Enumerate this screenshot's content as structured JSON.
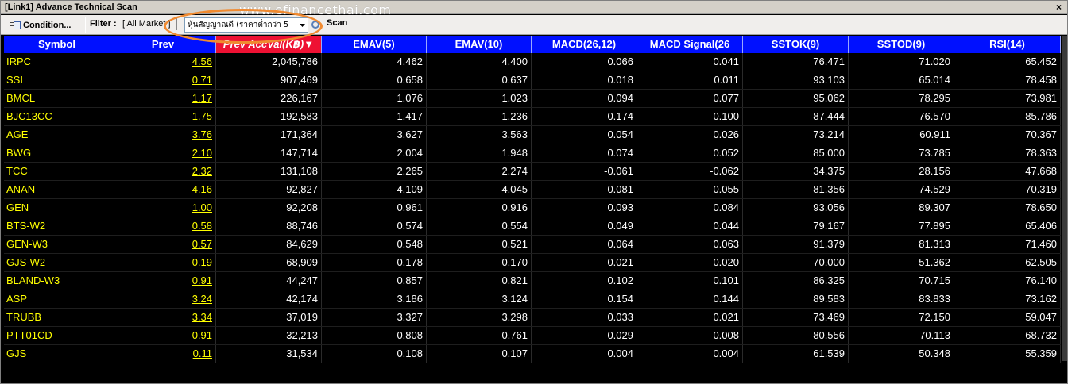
{
  "window": {
    "title": "[Link1] Advance Technical Scan",
    "close_glyph": "×",
    "watermark": "www.efinancethai.com"
  },
  "toolbar": {
    "condition_label": "Condition...",
    "filter_label": "Filter :",
    "filter_value": "[ All Market ]",
    "scan_select_value": "หุ้นสัญญาณดี (ราคาต่ำกว่า 5",
    "scan_label": "Scan"
  },
  "grid": {
    "columns": [
      "Symbol",
      "Prev",
      "Prev AccVal(K฿)",
      "EMAV(5)",
      "EMAV(10)",
      "MACD(26,12)",
      "MACD Signal(26",
      "SSTOK(9)",
      "SSTOD(9)",
      "RSI(14)"
    ],
    "sort_indicator": "▼",
    "rows": [
      [
        "IRPC",
        "4.56",
        "2,045,786",
        "4.462",
        "4.400",
        "0.066",
        "0.041",
        "76.471",
        "71.020",
        "65.452"
      ],
      [
        "SSI",
        "0.71",
        "907,469",
        "0.658",
        "0.637",
        "0.018",
        "0.011",
        "93.103",
        "65.014",
        "78.458"
      ],
      [
        "BMCL",
        "1.17",
        "226,167",
        "1.076",
        "1.023",
        "0.094",
        "0.077",
        "95.062",
        "78.295",
        "73.981"
      ],
      [
        "BJC13CC",
        "1.75",
        "192,583",
        "1.417",
        "1.236",
        "0.174",
        "0.100",
        "87.444",
        "76.570",
        "85.786"
      ],
      [
        "AGE",
        "3.76",
        "171,364",
        "3.627",
        "3.563",
        "0.054",
        "0.026",
        "73.214",
        "60.911",
        "70.367"
      ],
      [
        "BWG",
        "2.10",
        "147,714",
        "2.004",
        "1.948",
        "0.074",
        "0.052",
        "85.000",
        "73.785",
        "78.363"
      ],
      [
        "TCC",
        "2.32",
        "131,108",
        "2.265",
        "2.274",
        "-0.061",
        "-0.062",
        "34.375",
        "28.156",
        "47.668"
      ],
      [
        "ANAN",
        "4.16",
        "92,827",
        "4.109",
        "4.045",
        "0.081",
        "0.055",
        "81.356",
        "74.529",
        "70.319"
      ],
      [
        "GEN",
        "1.00",
        "92,208",
        "0.961",
        "0.916",
        "0.093",
        "0.084",
        "93.056",
        "89.307",
        "78.650"
      ],
      [
        "BTS-W2",
        "0.58",
        "88,746",
        "0.574",
        "0.554",
        "0.049",
        "0.044",
        "79.167",
        "77.895",
        "65.406"
      ],
      [
        "GEN-W3",
        "0.57",
        "84,629",
        "0.548",
        "0.521",
        "0.064",
        "0.063",
        "91.379",
        "81.313",
        "71.460"
      ],
      [
        "GJS-W2",
        "0.19",
        "68,909",
        "0.178",
        "0.170",
        "0.021",
        "0.020",
        "70.000",
        "51.362",
        "62.505"
      ],
      [
        "BLAND-W3",
        "0.91",
        "44,247",
        "0.857",
        "0.821",
        "0.102",
        "0.101",
        "86.325",
        "70.715",
        "76.140"
      ],
      [
        "ASP",
        "3.24",
        "42,174",
        "3.186",
        "3.124",
        "0.154",
        "0.144",
        "89.583",
        "83.833",
        "73.162"
      ],
      [
        "TRUBB",
        "3.34",
        "37,019",
        "3.327",
        "3.298",
        "0.033",
        "0.021",
        "73.469",
        "72.150",
        "59.047"
      ],
      [
        "PTT01CD",
        "0.91",
        "32,213",
        "0.808",
        "0.761",
        "0.029",
        "0.008",
        "80.556",
        "70.113",
        "68.732"
      ],
      [
        "GJS",
        "0.11",
        "31,534",
        "0.108",
        "0.107",
        "0.004",
        "0.004",
        "61.539",
        "50.348",
        "55.359"
      ]
    ]
  },
  "colors": {
    "header_bg": "#0010ff",
    "sorted_header_bg": "#ee1133",
    "symbol_text": "#ffff00",
    "value_text": "#ffffff",
    "grid_bg": "#000000",
    "highlight_ring": "#f08a30"
  },
  "icons": {
    "condition": "condition-icon",
    "scan": "scan-icon",
    "dropdown": "chevron-down-icon",
    "close": "close-icon"
  }
}
